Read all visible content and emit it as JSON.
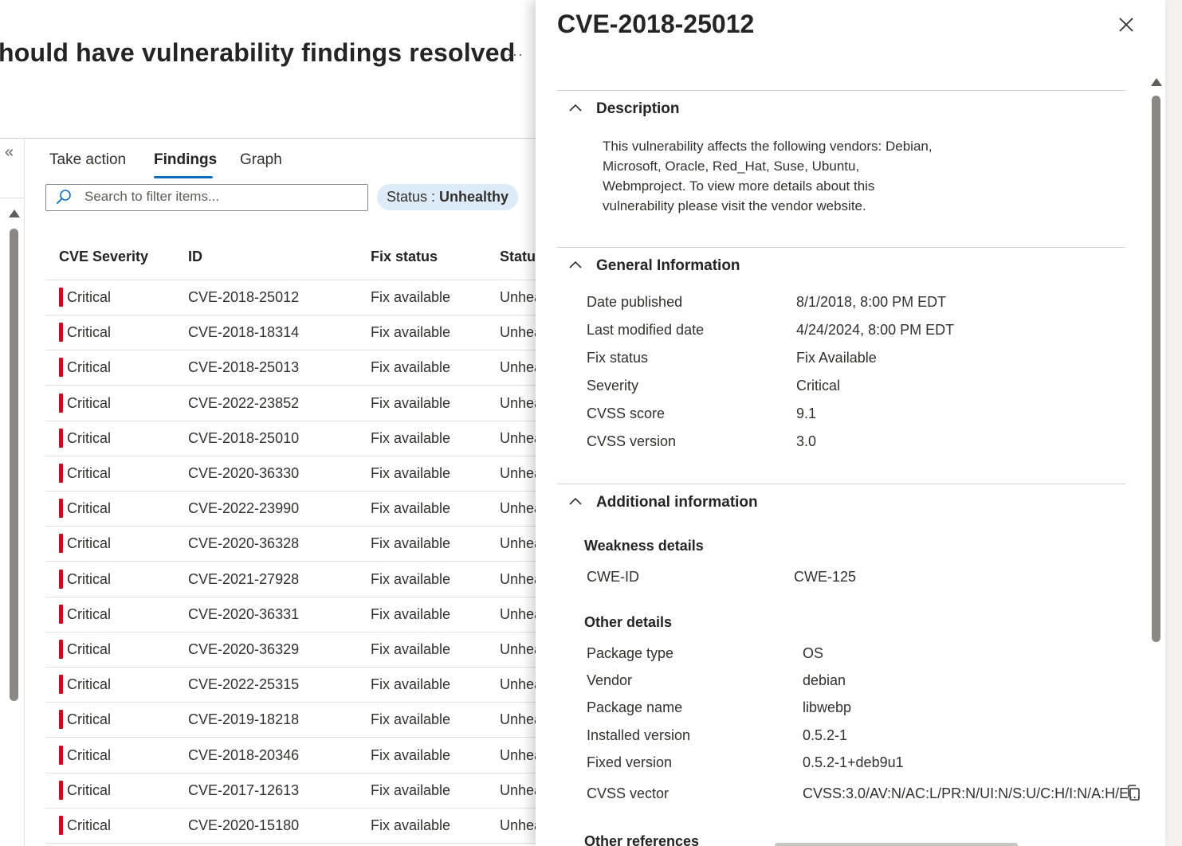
{
  "page": {
    "title": "hould have vulnerability findings resolved",
    "more_label": "···",
    "collapse_label": "«"
  },
  "tabs": [
    {
      "label": "Take action"
    },
    {
      "label": "Findings",
      "selected": true
    },
    {
      "label": "Graph"
    }
  ],
  "search": {
    "placeholder": "Search to filter items...",
    "value": ""
  },
  "filter": {
    "key": "Status : ",
    "value": "Unhealthy"
  },
  "table": {
    "headers": [
      "CVE Severity",
      "ID",
      "Fix status",
      "Status"
    ],
    "rows": [
      {
        "severity": "Critical",
        "id": "CVE-2018-25012",
        "fix": "Fix available",
        "status": "Unhea"
      },
      {
        "severity": "Critical",
        "id": "CVE-2018-18314",
        "fix": "Fix available",
        "status": "Unhea"
      },
      {
        "severity": "Critical",
        "id": "CVE-2018-25013",
        "fix": "Fix available",
        "status": "Unhea"
      },
      {
        "severity": "Critical",
        "id": "CVE-2022-23852",
        "fix": "Fix available",
        "status": "Unhea"
      },
      {
        "severity": "Critical",
        "id": "CVE-2018-25010",
        "fix": "Fix available",
        "status": "Unhea"
      },
      {
        "severity": "Critical",
        "id": "CVE-2020-36330",
        "fix": "Fix available",
        "status": "Unhea"
      },
      {
        "severity": "Critical",
        "id": "CVE-2022-23990",
        "fix": "Fix available",
        "status": "Unhea"
      },
      {
        "severity": "Critical",
        "id": "CVE-2020-36328",
        "fix": "Fix available",
        "status": "Unhea"
      },
      {
        "severity": "Critical",
        "id": "CVE-2021-27928",
        "fix": "Fix available",
        "status": "Unhea"
      },
      {
        "severity": "Critical",
        "id": "CVE-2020-36331",
        "fix": "Fix available",
        "status": "Unhea"
      },
      {
        "severity": "Critical",
        "id": "CVE-2020-36329",
        "fix": "Fix available",
        "status": "Unhea"
      },
      {
        "severity": "Critical",
        "id": "CVE-2022-25315",
        "fix": "Fix available",
        "status": "Unhea"
      },
      {
        "severity": "Critical",
        "id": "CVE-2019-18218",
        "fix": "Fix available",
        "status": "Unhea"
      },
      {
        "severity": "Critical",
        "id": "CVE-2018-20346",
        "fix": "Fix available",
        "status": "Unhea"
      },
      {
        "severity": "Critical",
        "id": "CVE-2017-12613",
        "fix": "Fix available",
        "status": "Unhea"
      },
      {
        "severity": "Critical",
        "id": "CVE-2020-15180",
        "fix": "Fix available",
        "status": "Unhea"
      }
    ],
    "severity_color": "#c50f1f"
  },
  "panel": {
    "title": "CVE-2018-25012",
    "description": {
      "heading": "Description",
      "text": "This vulnerability affects the following vendors: Debian, Microsoft, Oracle, Red_Hat, Suse, Ubuntu, Webmproject. To view more details about this vulnerability please visit the vendor website."
    },
    "general": {
      "heading": "General Information",
      "items": [
        {
          "k": "Date published",
          "v": "8/1/2018, 8:00 PM EDT"
        },
        {
          "k": "Last modified date",
          "v": "4/24/2024, 8:00 PM EDT"
        },
        {
          "k": "Fix status",
          "v": "Fix Available"
        },
        {
          "k": "Severity",
          "v": "Critical"
        },
        {
          "k": "CVSS score",
          "v": "9.1"
        },
        {
          "k": "CVSS version",
          "v": "3.0"
        }
      ]
    },
    "additional": {
      "heading": "Additional information",
      "weakness_heading": "Weakness details",
      "weakness": [
        {
          "k": "CWE-ID",
          "v": "CWE-125"
        }
      ],
      "other_heading": "Other details",
      "other": [
        {
          "k": "Package type",
          "v": "OS"
        },
        {
          "k": "Vendor",
          "v": "debian"
        },
        {
          "k": "Package name",
          "v": "libwebp"
        },
        {
          "k": "Installed version",
          "v": "0.5.2-1"
        },
        {
          "k": "Fixed version",
          "v": "0.5.2-1+deb9u1"
        },
        {
          "k": "CVSS vector",
          "v": "CVSS:3.0/AV:N/AC:L/PR:N/UI:N/S:U/C:H/I:N/A:H/E..."
        }
      ],
      "references_heading": "Other references"
    }
  },
  "icons": {
    "search": "search-icon",
    "close": "close-icon",
    "chevron": "chevron-up-icon",
    "copy": "copy-icon",
    "collapse": "double-chevron-left-icon"
  }
}
